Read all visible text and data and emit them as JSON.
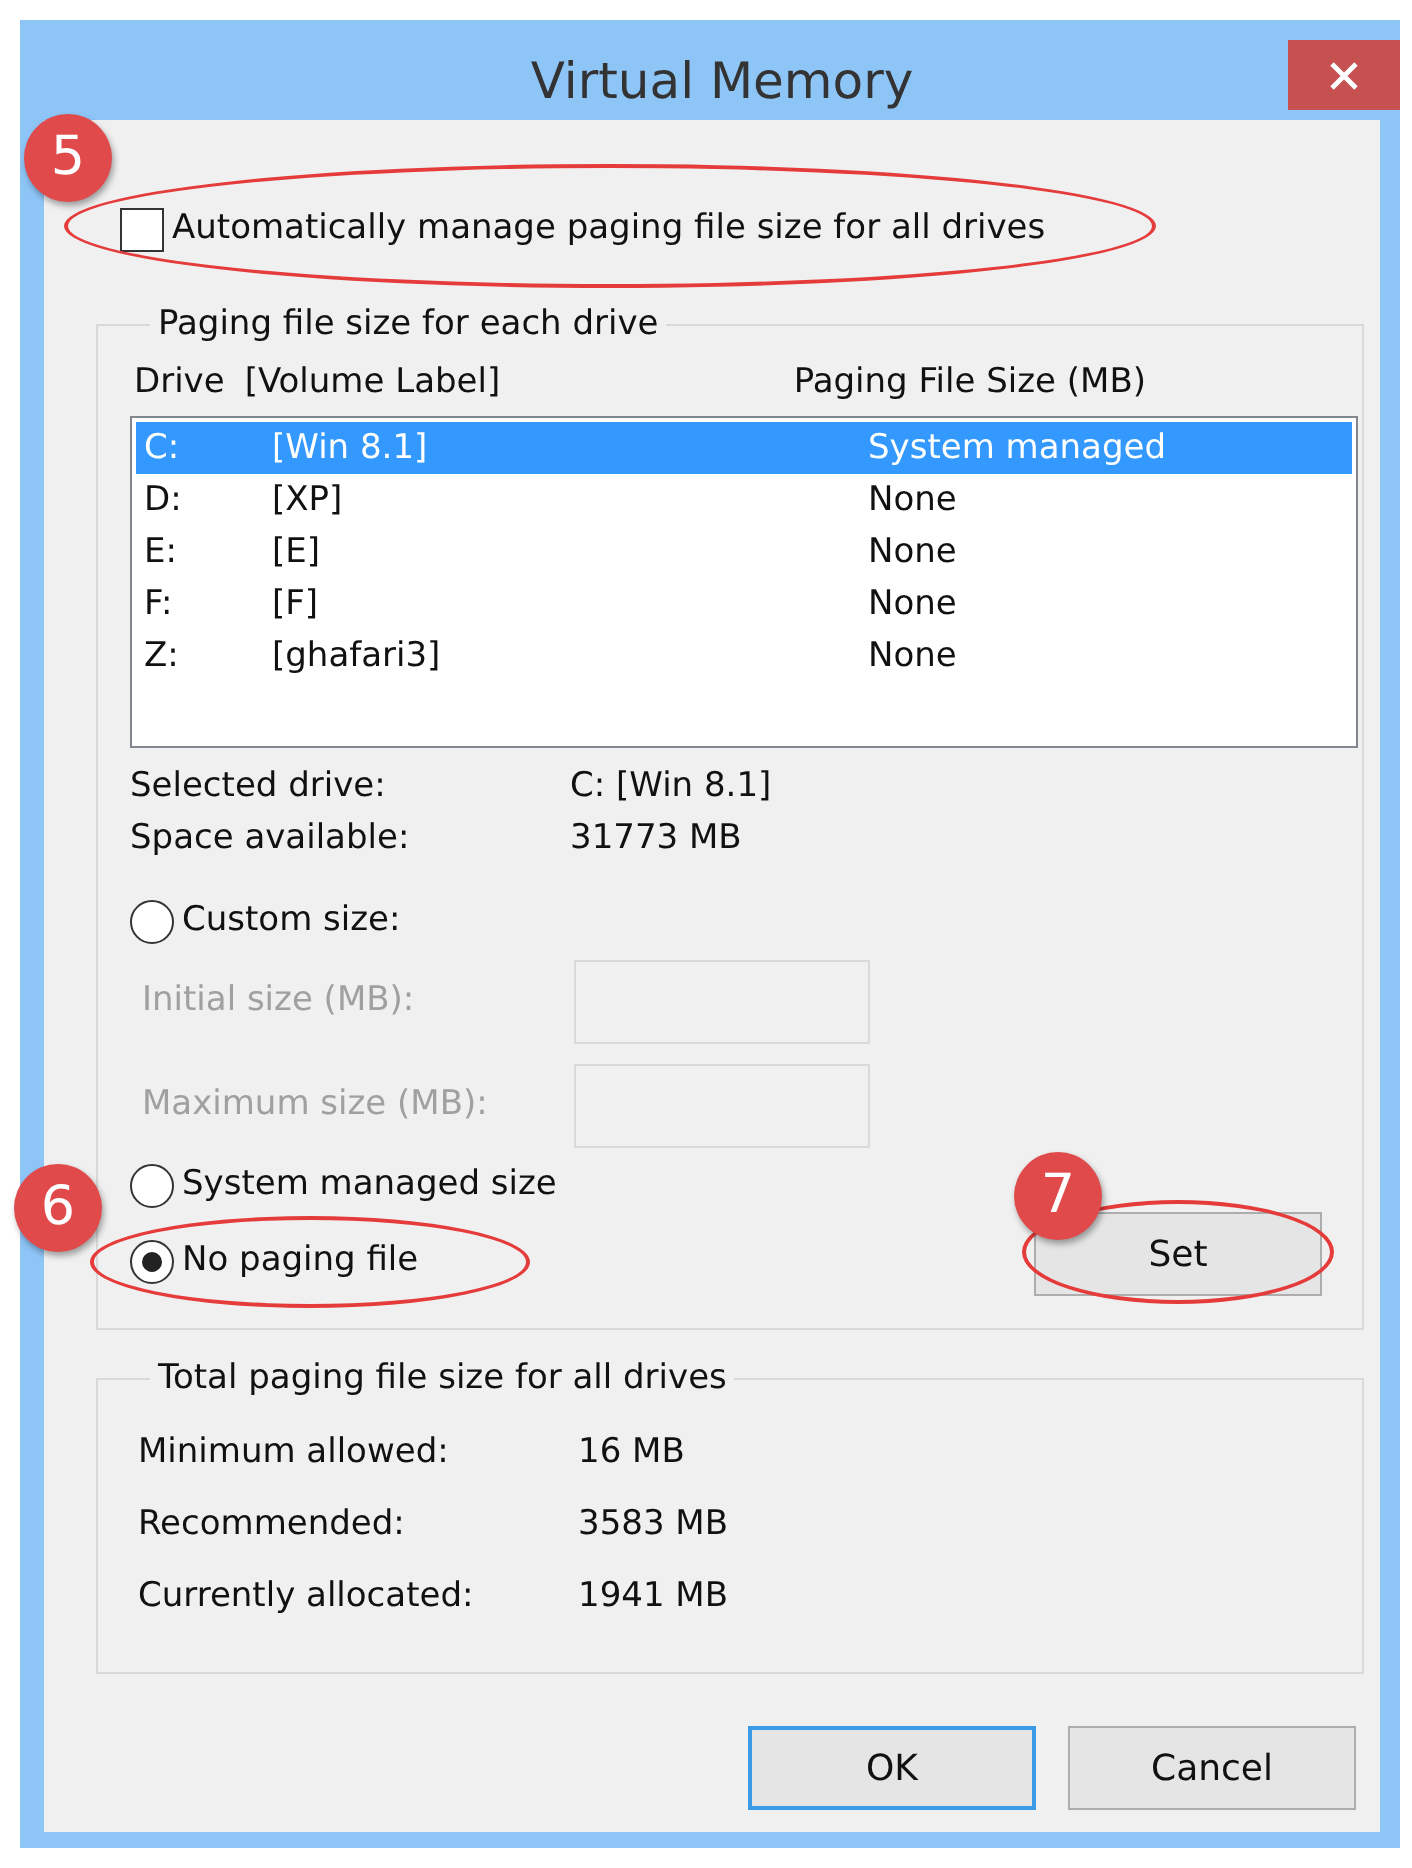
{
  "window": {
    "title": "Virtual Memory"
  },
  "auto_manage": {
    "label": "Automatically manage paging file size for all drives",
    "checked": false,
    "callout": "5"
  },
  "drive_group": {
    "legend": "Paging file size for each drive",
    "columns": [
      "Drive",
      "[Volume Label]",
      "Paging File Size (MB)"
    ],
    "drives": [
      {
        "drive": "C:",
        "label": "[Win 8.1]",
        "size": "System managed",
        "selected": true
      },
      {
        "drive": "D:",
        "label": "[XP]",
        "size": "None",
        "selected": false
      },
      {
        "drive": "E:",
        "label": "[E]",
        "size": "None",
        "selected": false
      },
      {
        "drive": "F:",
        "label": "[F]",
        "size": "None",
        "selected": false
      },
      {
        "drive": "Z:",
        "label": "[ghafari3]",
        "size": "None",
        "selected": false
      }
    ],
    "info": [
      {
        "label": "Selected drive:",
        "value": "C:  [Win 8.1]"
      },
      {
        "label": "Space available:",
        "value": "31773 MB"
      }
    ],
    "options": [
      {
        "label": "Custom size:",
        "selected": false,
        "fields": [
          {
            "label": "Initial size (MB):",
            "disabled": true
          },
          {
            "label": "Maximum size (MB):",
            "disabled": true
          }
        ]
      },
      {
        "label": "System managed size",
        "selected": false
      },
      {
        "label": "No paging file",
        "selected": true,
        "callout": "6"
      }
    ],
    "set_button": {
      "label": "Set",
      "callout": "7"
    }
  },
  "total_group": {
    "legend": "Total paging file size for all drives",
    "rows": [
      {
        "label": "Minimum allowed:",
        "value": "16 MB"
      },
      {
        "label": "Recommended:",
        "value": "3583 MB"
      },
      {
        "label": "Currently allocated:",
        "value": "1941 MB"
      }
    ]
  },
  "buttons": [
    {
      "label": "OK",
      "default": true
    },
    {
      "label": "Cancel",
      "default": false
    }
  ]
}
